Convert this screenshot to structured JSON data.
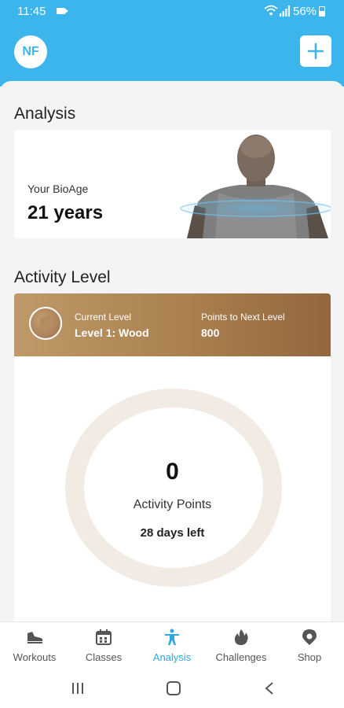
{
  "status_bar": {
    "time": "11:45",
    "battery_pct": "56%",
    "icons": [
      "camera-icon",
      "wifi-icon",
      "signal-icon",
      "battery-icon"
    ]
  },
  "header": {
    "avatar_initials": "NF",
    "add_icon": "plus-icon"
  },
  "analysis": {
    "title": "Analysis",
    "bioage_label": "Your BioAge",
    "bioage_value": "21 years"
  },
  "activity": {
    "title": "Activity Level",
    "current_level_label": "Current Level",
    "current_level_value": "Level 1: Wood",
    "points_next_label": "Points to Next Level",
    "points_next_value": "800",
    "points_value": "0",
    "points_label": "Activity Points",
    "days_left": "28 days left",
    "progress_fraction": 0
  },
  "bottom_nav": {
    "items": [
      {
        "label": "Workouts",
        "icon": "shoe-icon"
      },
      {
        "label": "Classes",
        "icon": "calendar-icon"
      },
      {
        "label": "Analysis",
        "icon": "person-icon",
        "active": true
      },
      {
        "label": "Challenges",
        "icon": "flame-icon"
      },
      {
        "label": "Shop",
        "icon": "location-pin-icon"
      }
    ]
  },
  "colors": {
    "brand": "#3cb4ec",
    "active_nav": "#2da8e0",
    "wood": "#a9804f",
    "ring_track": "#f1ebe3"
  }
}
